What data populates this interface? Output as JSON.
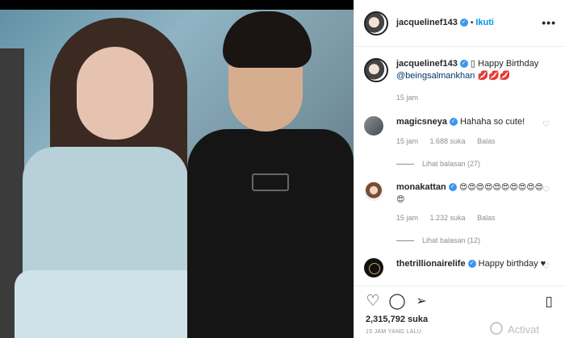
{
  "post": {
    "username": "jacquelinef143",
    "follow_label": "Ikuti",
    "dot": "•",
    "more_label": "•••",
    "verified_glyph": "✓",
    "caption_prefix": "▯ Happy Birthday",
    "caption_mention": "@beingsalmankhan",
    "caption_emoji": "💋💋💋",
    "caption_time": "15 jam"
  },
  "comments": [
    {
      "username": "magicsneya",
      "text": "Hahaha so cute!",
      "time": "15 jam",
      "likes": "1.688 suka",
      "reply_label": "Balas",
      "view_replies": "Lihat balasan (27)"
    },
    {
      "username": "monakattan",
      "text": "😍😍😍😍😍😍😍😍😍😍😍",
      "time": "15 jam",
      "likes": "1.232 suka",
      "reply_label": "Balas",
      "view_replies": "Lihat balasan (12)"
    },
    {
      "username": "thetrillionairelife",
      "text": "Happy birthday ♥",
      "time": "",
      "likes": "",
      "reply_label": "",
      "view_replies": ""
    }
  ],
  "actions": {
    "like_icon": "heart-outline",
    "comment_icon": "comment-bubble",
    "share_icon": "paper-plane",
    "save_icon": "bookmark",
    "likes_count": "2,315,792 suka",
    "timestamp": "15 JAM YANG LALU"
  },
  "overlay": {
    "activate_text": "Activat"
  },
  "colors": {
    "link_blue": "#0095f6",
    "mention_blue": "#00376b",
    "meta_gray": "#8e8e8e",
    "verified_blue": "#3897f0"
  }
}
